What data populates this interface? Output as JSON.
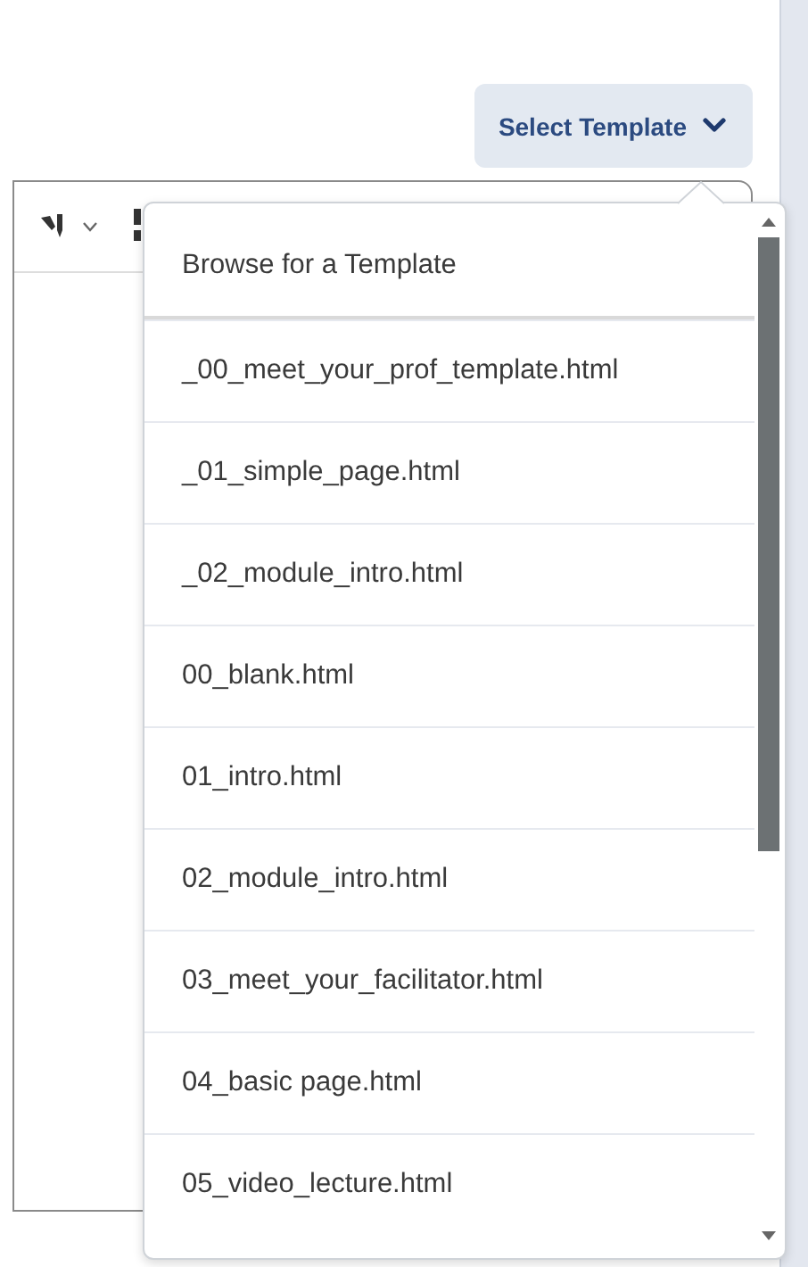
{
  "template_button": {
    "label": "Select Template"
  },
  "template_menu": {
    "header": "Browse for a Template",
    "items": [
      "_00_meet_your_prof_template.html",
      "_01_simple_page.html",
      "_02_module_intro.html",
      "00_blank.html",
      "01_intro.html",
      "02_module_intro.html",
      "03_meet_your_facilitator.html",
      "04_basic page.html",
      "05_video_lecture.html"
    ]
  }
}
